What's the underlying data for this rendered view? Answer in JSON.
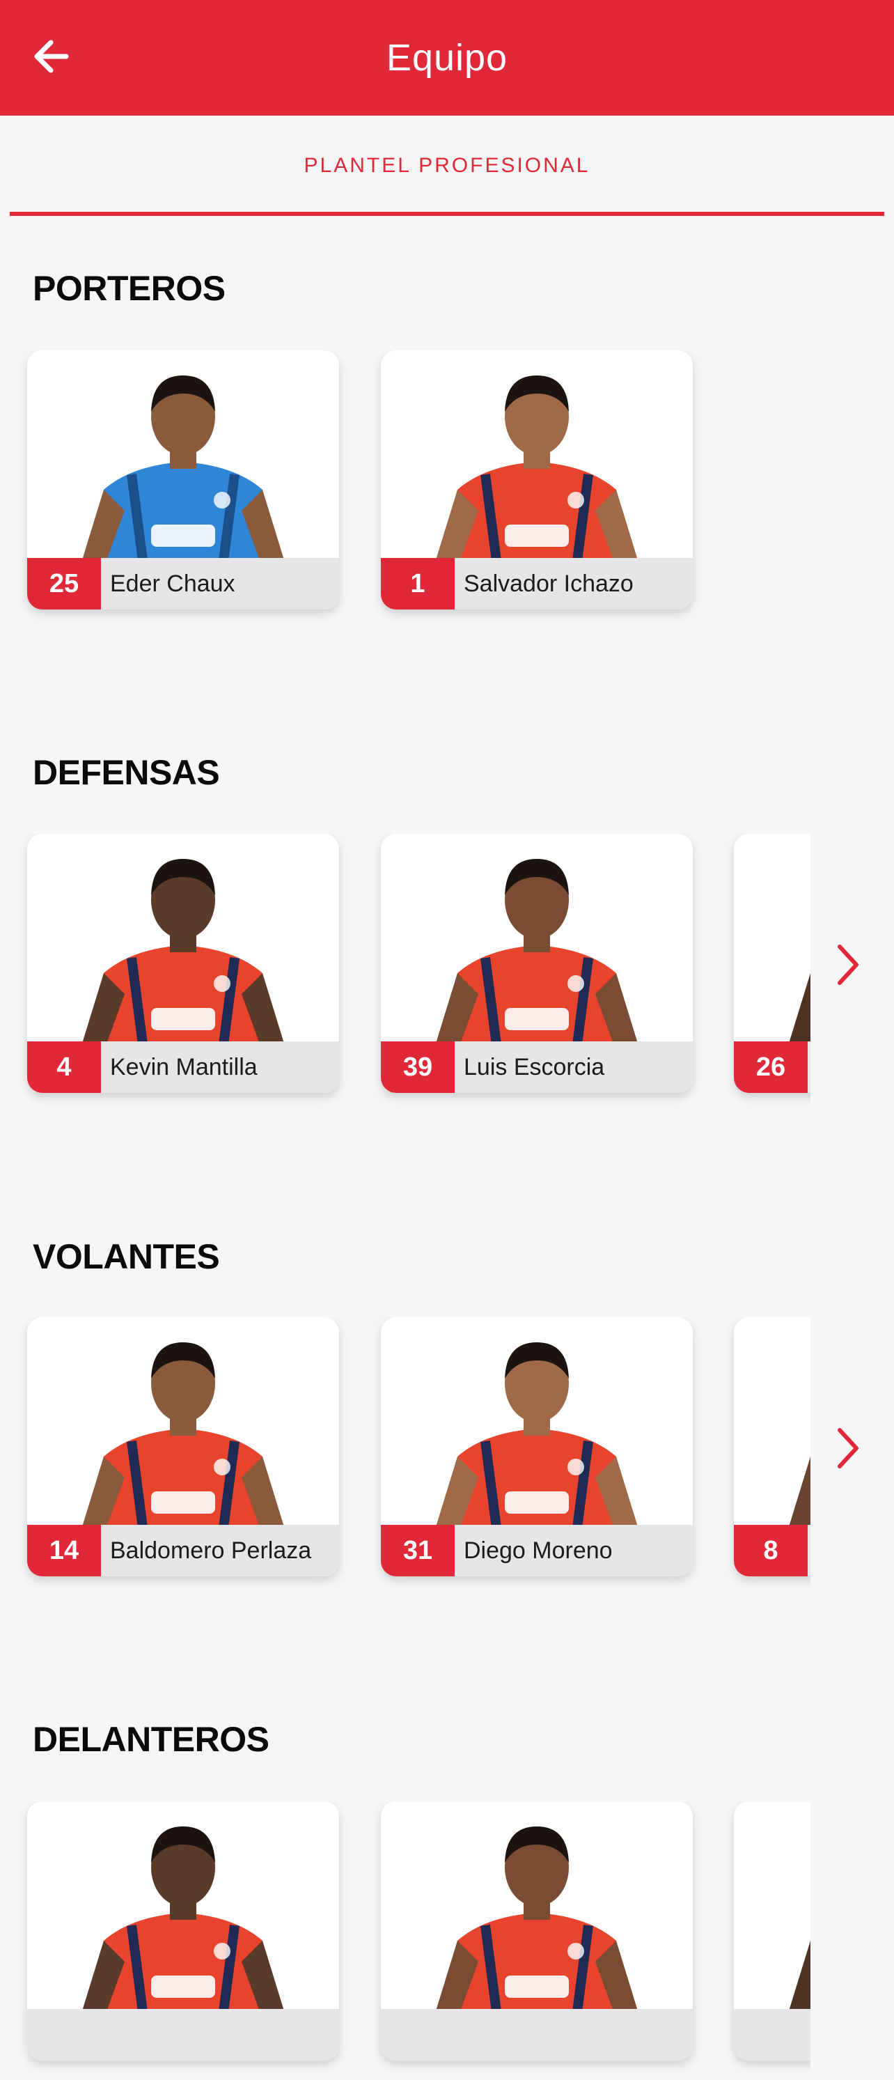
{
  "header": {
    "title": "Equipo",
    "back_icon": "arrow-left-icon"
  },
  "tabs": [
    {
      "label": "PLANTEL PROFESIONAL",
      "active": true
    }
  ],
  "colors": {
    "brand_red": "#e02838",
    "background": "#f6f6f7",
    "name_bar": "#e6e6e8"
  },
  "sections": [
    {
      "title": "PORTEROS",
      "players": [
        {
          "number": "25",
          "name": "Eder Chaux",
          "kit": "goalkeeper-blue"
        },
        {
          "number": "1",
          "name": "Salvador Ichazo",
          "kit": "red-home"
        }
      ],
      "has_more": false
    },
    {
      "title": "DEFENSAS",
      "players": [
        {
          "number": "4",
          "name": "Kevin Mantilla",
          "kit": "red-home"
        },
        {
          "number": "39",
          "name": "Luis Escorcia",
          "kit": "red-home"
        },
        {
          "number": "26",
          "name": "",
          "kit": "red-home"
        }
      ],
      "has_more": true
    },
    {
      "title": "VOLANTES",
      "players": [
        {
          "number": "14",
          "name": "Baldomero Perlaza",
          "kit": "red-home"
        },
        {
          "number": "31",
          "name": "Diego Moreno",
          "kit": "red-home"
        },
        {
          "number": "8",
          "name": "",
          "kit": "red-home"
        }
      ],
      "has_more": true
    },
    {
      "title": "DELANTEROS",
      "players": [
        {
          "number": "",
          "name": "",
          "kit": "red-home"
        },
        {
          "number": "",
          "name": "",
          "kit": "red-home"
        },
        {
          "number": "",
          "name": "",
          "kit": "red-home"
        }
      ],
      "has_more": false
    }
  ]
}
